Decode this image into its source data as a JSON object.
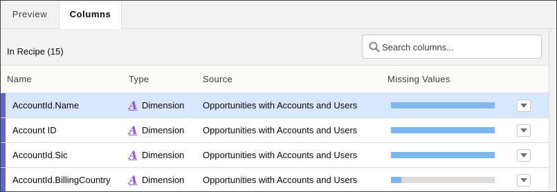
{
  "tabs": [
    {
      "label": "Preview",
      "active": false
    },
    {
      "label": "Columns",
      "active": true
    }
  ],
  "toolbar": {
    "count_label": "In Recipe (15)",
    "search": {
      "placeholder": "Search columns...",
      "icon": "search-icon"
    }
  },
  "table": {
    "headers": [
      "Name",
      "Type",
      "Source",
      "Missing Values"
    ],
    "rows": [
      {
        "name": "AccountId.Name",
        "type_icon": "A",
        "type": "Dimension",
        "source": "Opportunities with Accounts and Users",
        "missing_fill": 1.0,
        "selected": true
      },
      {
        "name": "Account ID",
        "type_icon": "A",
        "type": "Dimension",
        "source": "Opportunities with Accounts and Users",
        "missing_fill": 1.0,
        "selected": false
      },
      {
        "name": "AccountId.Sic",
        "type_icon": "A",
        "type": "Dimension",
        "source": "Opportunities with Accounts and Users",
        "missing_fill": 1.0,
        "selected": false
      },
      {
        "name": "AccountId.BillingCountry",
        "type_icon": "A",
        "type": "Dimension",
        "source": "Opportunities with Accounts and Users",
        "missing_fill": 0.1,
        "selected": false
      }
    ]
  },
  "colors": {
    "accent_marker": "#6165c8",
    "selected_row": "#d8e6fe",
    "bar_fill": "#7db7ee",
    "bar_track": "#dddbda",
    "dimension_icon": "#9050e9"
  }
}
